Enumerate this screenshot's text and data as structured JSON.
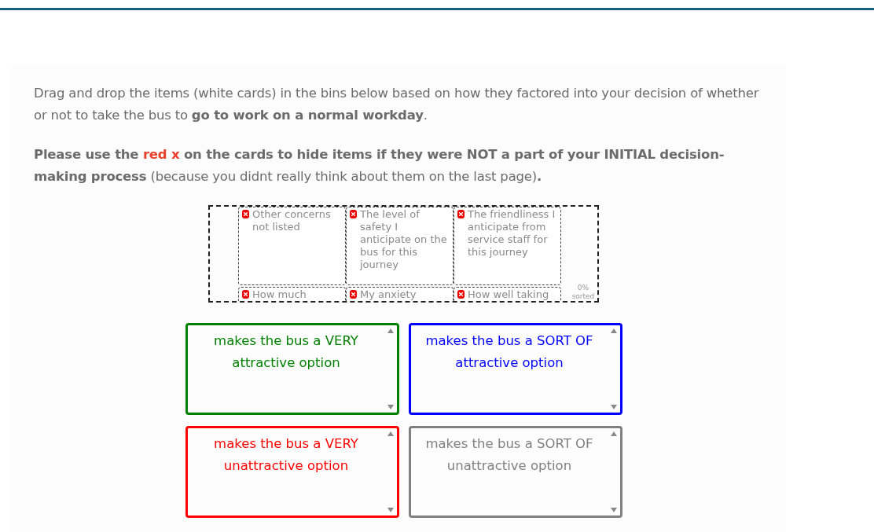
{
  "instructions": [
    {
      "segments": [
        {
          "kind": "plain",
          "text": "Drag and drop the items (white cards) in the bins below based on how they factored into your decision of whether or not to take the bus to "
        },
        {
          "kind": "bold",
          "text": "go to work on a normal workday"
        },
        {
          "kind": "plain",
          "text": "."
        }
      ]
    },
    {
      "segments": [
        {
          "kind": "bold",
          "text": "Please use the "
        },
        {
          "kind": "red",
          "text": "red x"
        },
        {
          "kind": "bold",
          "text": " on the cards to hide items if they were NOT a part of your INITIAL decision-making process"
        },
        {
          "kind": "plain",
          "text": " (because you didnt really think about them on the last page)"
        },
        {
          "kind": "bold",
          "text": "."
        }
      ]
    }
  ],
  "cards": [
    {
      "label": "Other concerns not listed"
    },
    {
      "label": "The level of safety I anticipate on the bus for this journey"
    },
    {
      "label": "The friendliness I anticipate from service staff for this journey"
    },
    {
      "label": "How much"
    },
    {
      "label": "My anxiety"
    },
    {
      "label": "How well taking"
    }
  ],
  "progress": "0% sorted",
  "bins": [
    {
      "label": "makes the bus a VERY attractive option",
      "color": "#008000"
    },
    {
      "label": "makes the bus a SORT OF attractive option",
      "color": "#0000ff"
    },
    {
      "label": "makes the bus a VERY unattractive option",
      "color": "#ff0000"
    },
    {
      "label": "makes the bus a SORT OF unattractive option",
      "color": "#808080"
    }
  ]
}
